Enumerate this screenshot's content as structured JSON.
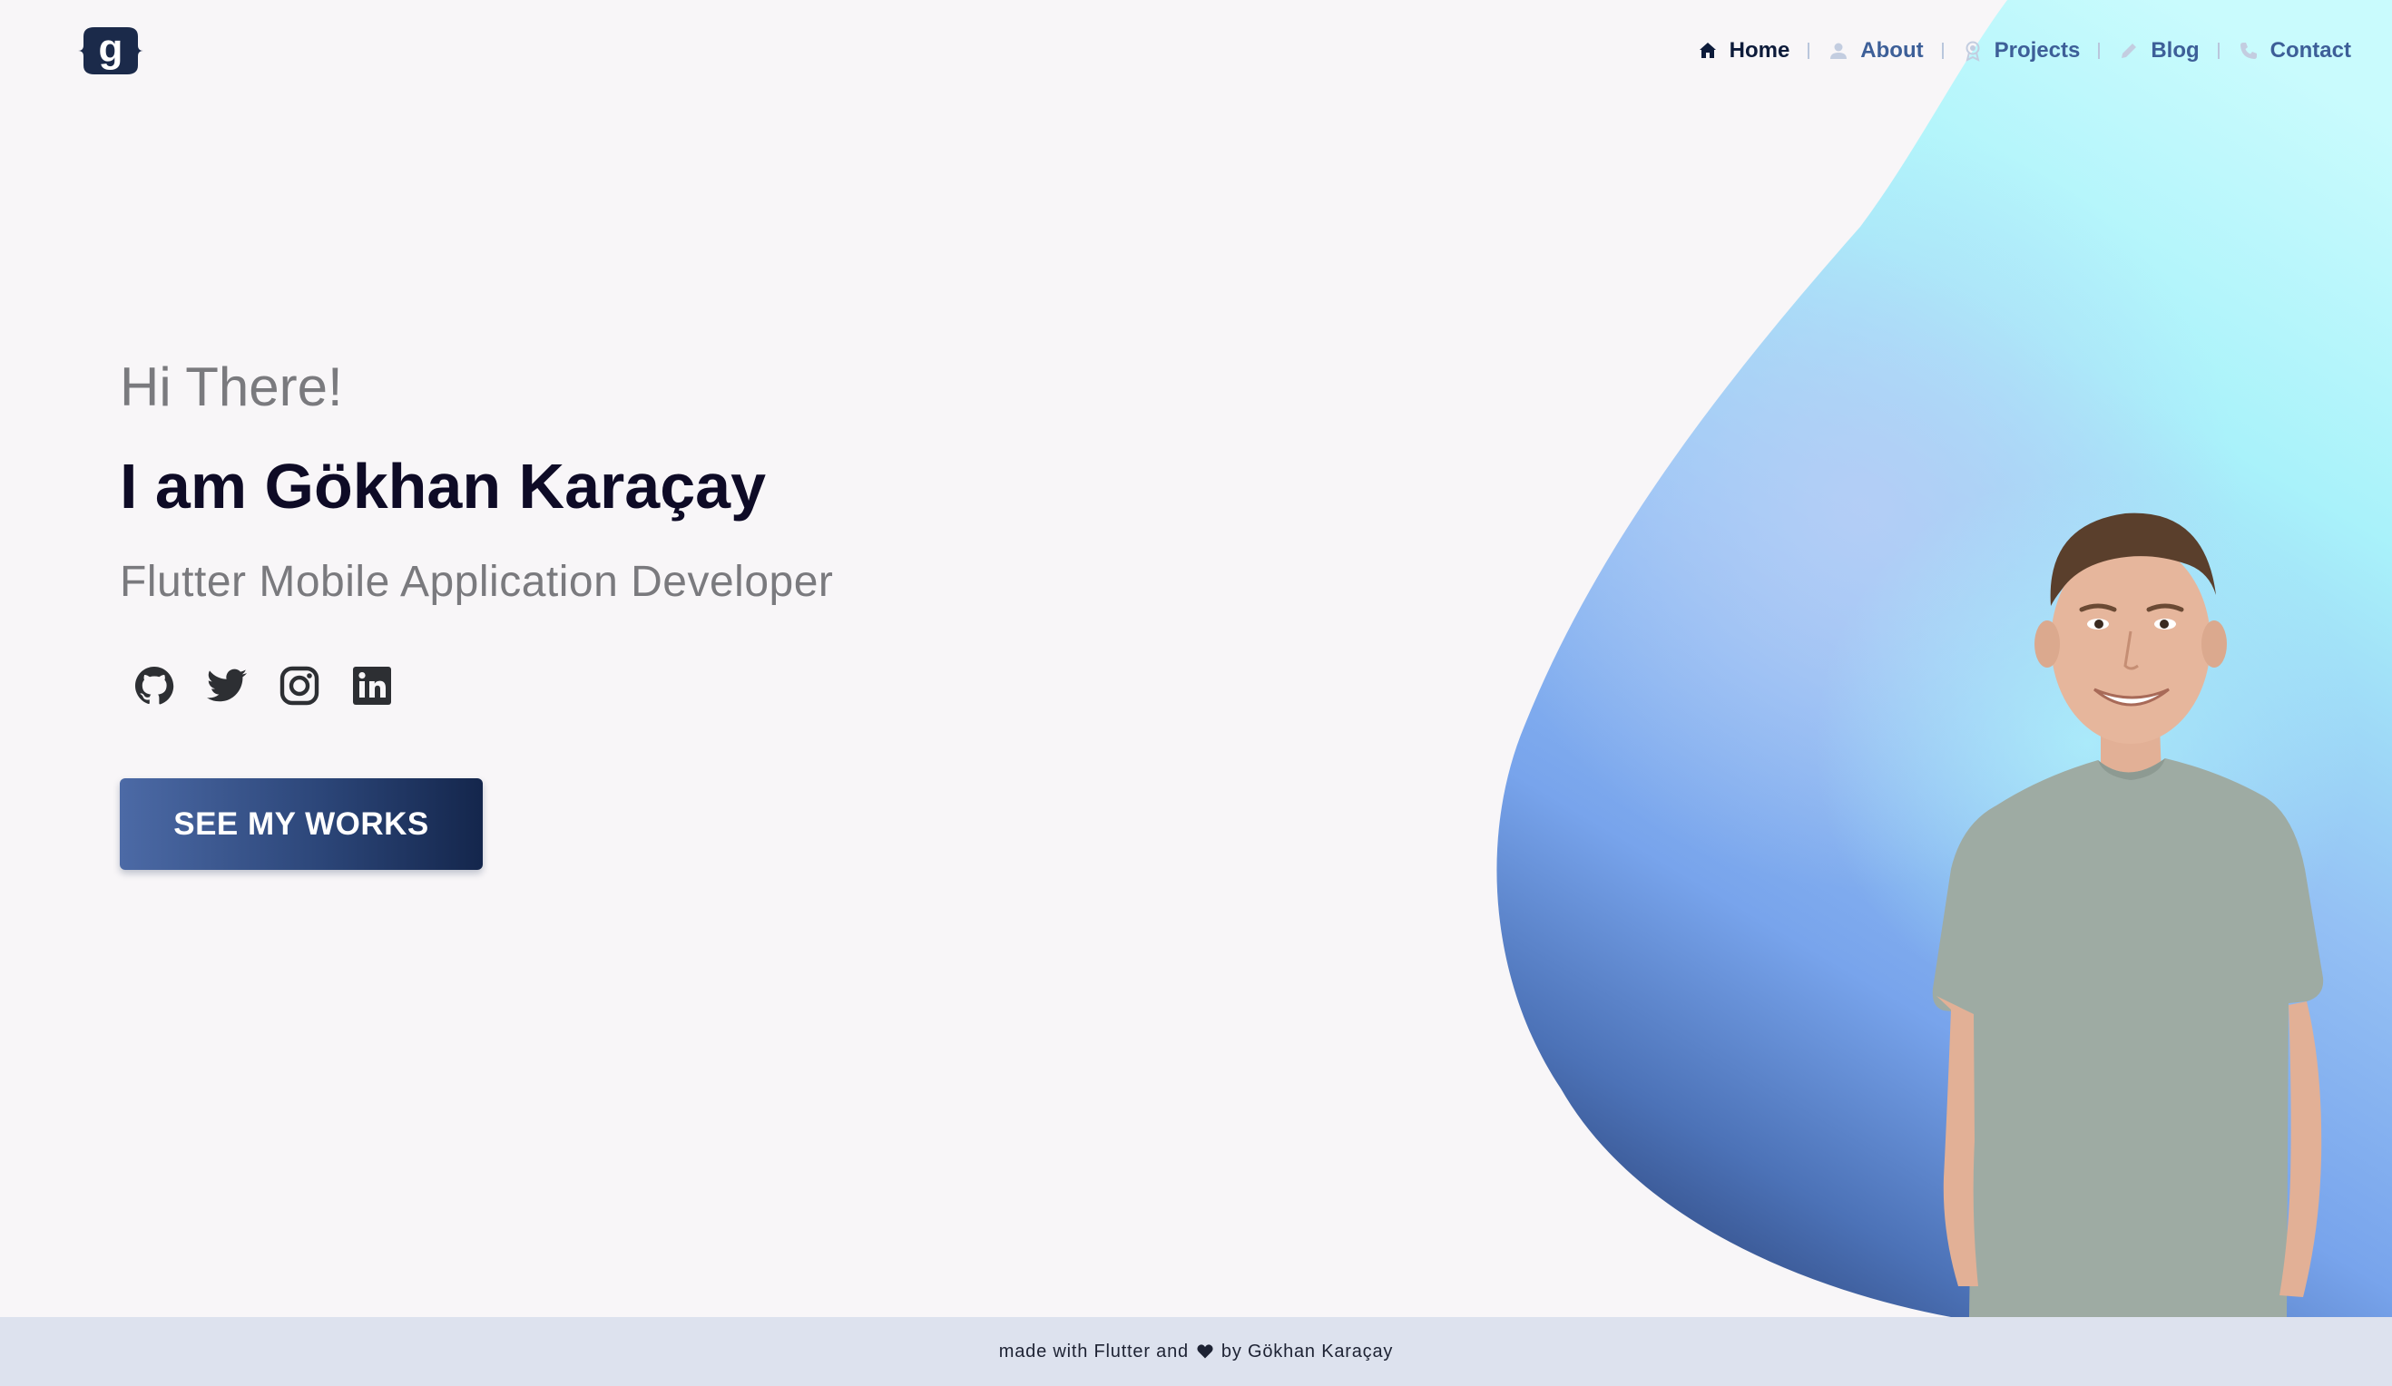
{
  "logo": {
    "letter": "g",
    "icon": "logo-g-icon"
  },
  "nav": [
    {
      "label": "Home",
      "icon": "home-icon",
      "active": true
    },
    {
      "label": "About",
      "icon": "person-icon",
      "active": false
    },
    {
      "label": "Projects",
      "icon": "award-icon",
      "active": false
    },
    {
      "label": "Blog",
      "icon": "pencil-icon",
      "active": false
    },
    {
      "label": "Contact",
      "icon": "phone-icon",
      "active": false
    }
  ],
  "hero": {
    "greeting": "Hi There!",
    "name": "I am Gökhan Karaçay",
    "role": "Flutter Mobile Application Developer",
    "cta_label": "SEE MY WORKS"
  },
  "socials": [
    {
      "icon": "github-icon"
    },
    {
      "icon": "twitter-icon"
    },
    {
      "icon": "instagram-icon"
    },
    {
      "icon": "linkedin-icon"
    }
  ],
  "footer": {
    "prefix": "made with Flutter and",
    "icon": "heart-icon",
    "suffix": "by Gökhan Karaçay"
  },
  "colors": {
    "background": "#f8f6f8",
    "nav_link": "#3d5f98",
    "nav_active": "#0d1b3a",
    "heading": "#0e0b26",
    "muted_text": "#7a7a7e",
    "button_start": "#4c6aa6",
    "button_end": "#14264c",
    "footer_bg": "#dde2ee",
    "blob_light": "#c9fbfd",
    "blob_mid": "#7fa8ee",
    "blob_dark": "#24386a"
  }
}
